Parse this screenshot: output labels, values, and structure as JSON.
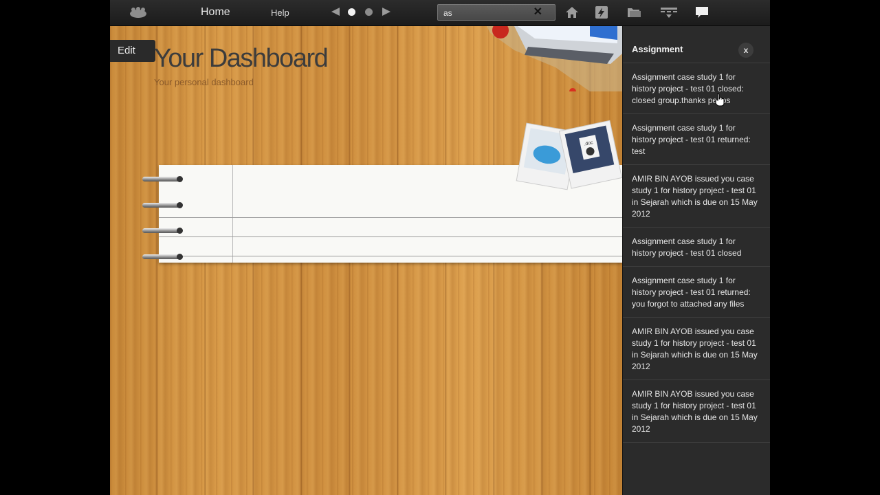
{
  "topbar": {
    "logo_icon": "cloud-logo-icon",
    "home_label": "Home",
    "help_label": "Help",
    "prev_icon": "left-arrow-icon",
    "next_icon": "right-arrow-icon",
    "search_value": "as",
    "search_clear_icon": "close-x-icon",
    "icons": [
      "home-icon",
      "lightning-icon",
      "folder-icon",
      "keyboard-menu-icon",
      "chat-bubble-icon"
    ]
  },
  "dashboard": {
    "edit_label": "Edit",
    "title": "Your Dashboard",
    "subtitle": "Your personal dashboard"
  },
  "panel": {
    "title": "Assignment",
    "close_label": "x",
    "notifications": [
      "Assignment case study 1 for history project - test 01 closed: closed group.thanks peeps",
      "Assignment case study 1 for history project - test 01 returned: test",
      "AMIR BIN AYOB issued you case study 1 for history project - test 01 in Sejarah which is due on 15 May 2012",
      "Assignment case study 1 for history project - test 01 closed",
      "Assignment case study 1 for history project - test 01 returned: you forgot to attached any files",
      "AMIR BIN AYOB issued you case study 1 for history project - test 01 in Sejarah which is due on 15 May 2012",
      "AMIR BIN AYOB issued you case study 1 for history project - test 01 in Sejarah which is due on 15 May 2012"
    ]
  },
  "decor": {
    "photo_label": ".doc"
  },
  "colors": {
    "topbar": "#1f1f1f",
    "panel": "#2b2b2b",
    "wood": "#d4953f",
    "title_text": "#3c3c3c"
  }
}
